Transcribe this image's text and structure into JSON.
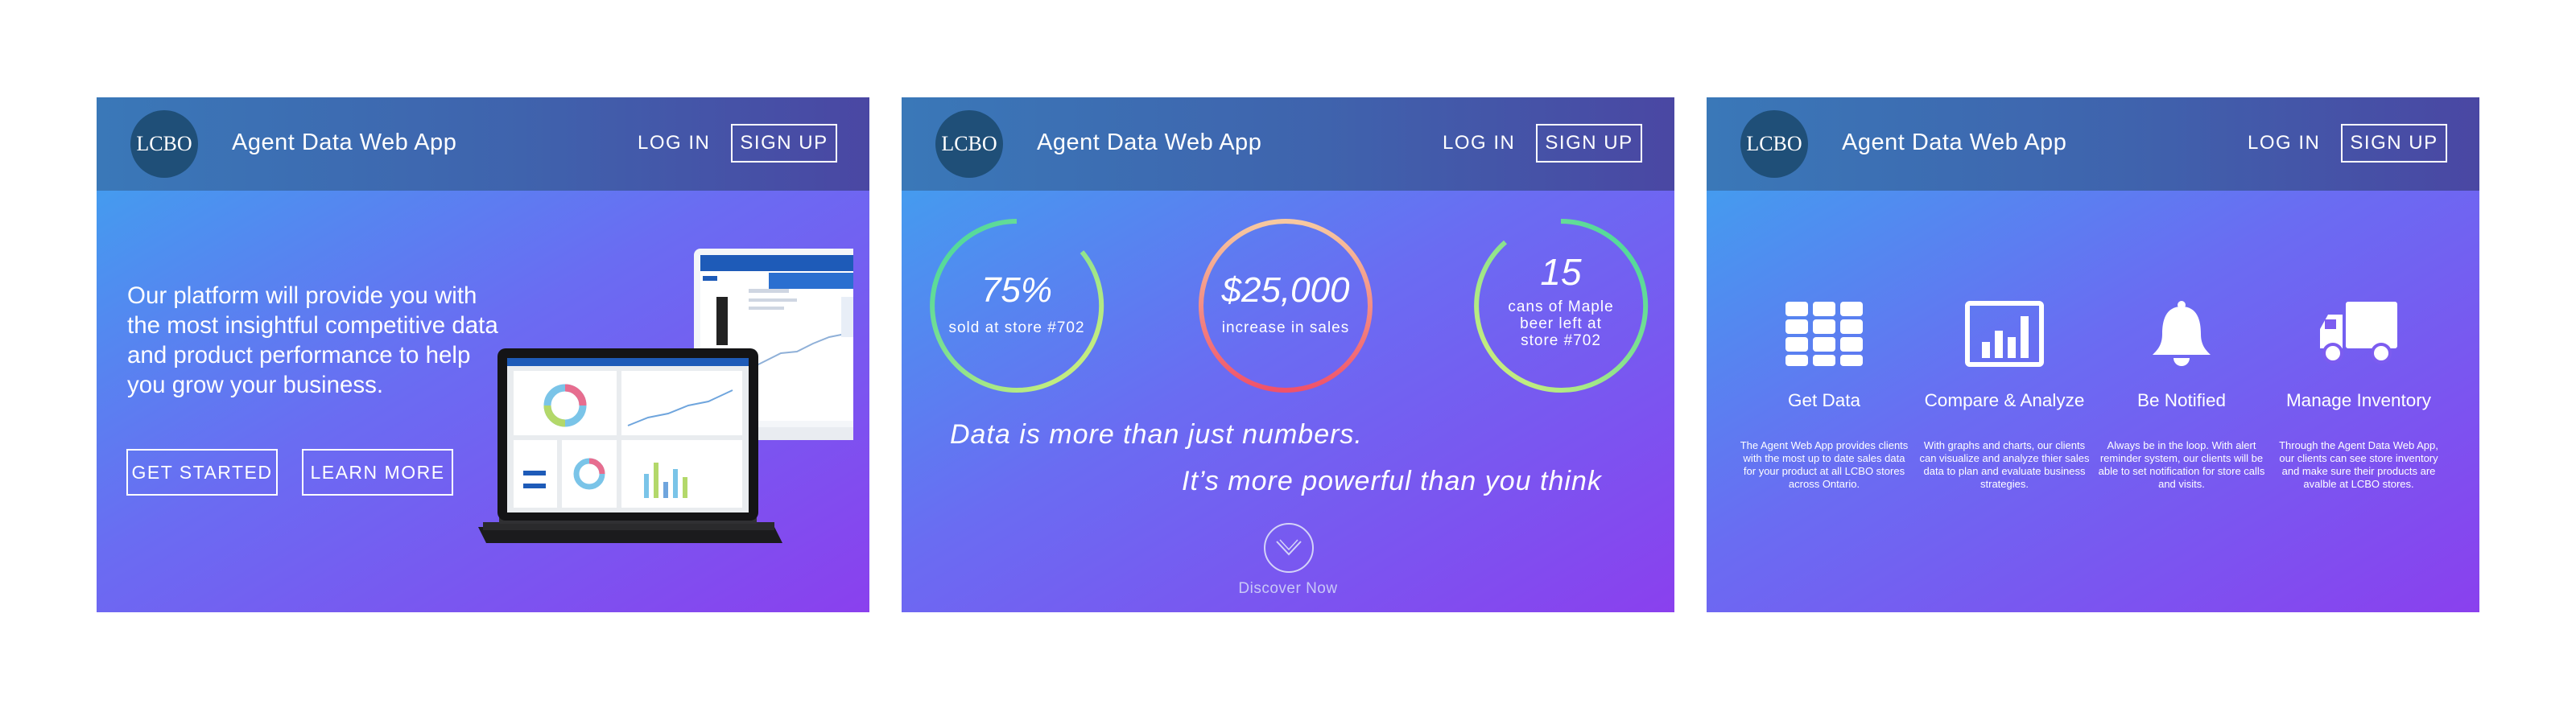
{
  "header": {
    "logo_text": "LCBO",
    "app_title": "Agent Data Web App",
    "login_label": "LOG IN",
    "signup_label": "SIGN UP"
  },
  "panel1": {
    "headline": "Our platform will provide you with the most insightful competitive data and product performance to help you grow your business.",
    "get_started_label": "GET STARTED",
    "learn_more_label": "LEARN MORE"
  },
  "panel2": {
    "stats": [
      {
        "value": "75%",
        "caption": "sold at store #702"
      },
      {
        "value": "$25,000",
        "caption": "increase in sales"
      },
      {
        "value": "15",
        "caption": "cans of Maple beer left at store #702"
      }
    ],
    "tagline_line1": "Data is more than just numbers.",
    "tagline_line2": "It’s more powerful than you think",
    "discover_label": "Discover Now"
  },
  "panel3": {
    "features": [
      {
        "title": "Get Data",
        "icon": "grid-icon",
        "description": "The Agent Web App provides clients with the most up to date sales data for your product at all LCBO stores across Ontario."
      },
      {
        "title": "Compare & Analyze",
        "icon": "bar-chart-icon",
        "description": "With graphs and charts, our clients can visualize and analyze thier sales data to plan and evaluate business strategies."
      },
      {
        "title": "Be Notified",
        "icon": "bell-icon",
        "description": "Always be in the loop. With alert reminder system, our clients will be able to set notification for store calls and visits."
      },
      {
        "title": "Manage Inventory",
        "icon": "truck-icon",
        "description": "Through the Agent Data Web App, our clients can see store inventory and make sure their products are avalble at LCBO stores."
      }
    ]
  },
  "colors": {
    "gradient_start": "#3ba7ee",
    "gradient_mid": "#6a6cf2",
    "gradient_end": "#8a40ee",
    "header_bar": "#3f63ad",
    "logo_circle": "#1f4f78"
  }
}
